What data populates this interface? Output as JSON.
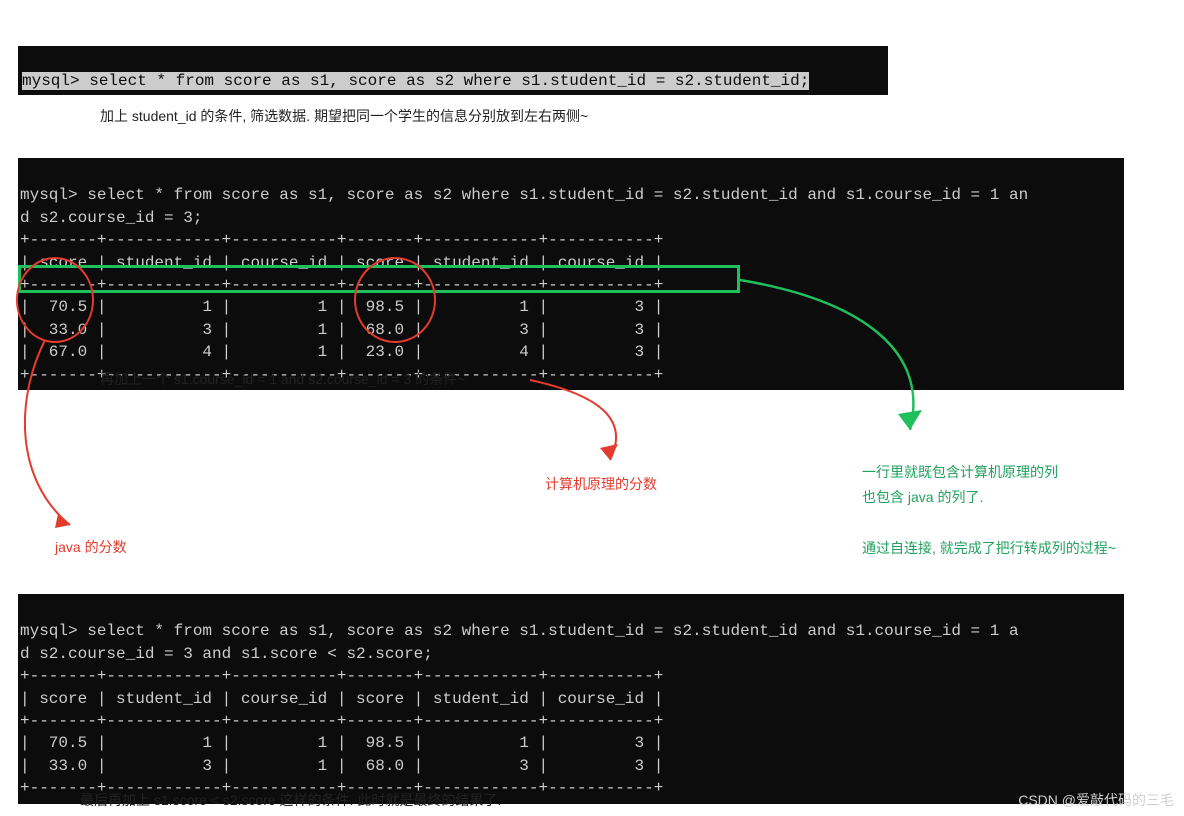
{
  "block1": {
    "line": "mysql> select * from score as s1, score as s2 where s1.student_id = s2.student_id;"
  },
  "caption1": "加上 student_id 的条件, 筛选数据. 期望把同一个学生的信息分别放到左右两侧~",
  "block2": {
    "query_l1": "mysql> select * from score as s1, score as s2 where s1.student_id = s2.student_id and s1.course_id = 1 an",
    "query_l2": "d s2.course_id = 3;",
    "sep": "+-------+------------+-----------+-------+------------+-----------+",
    "header": "| score | student_id | course_id | score | student_id | course_id |",
    "row1": "|  70.5 |          1 |         1 |  98.5 |          1 |         3 |",
    "row2": "|  33.0 |          3 |         1 |  68.0 |          3 |         3 |",
    "row3": "|  67.0 |          4 |         1 |  23.0 |          4 |         3 |"
  },
  "caption2": "再加上一个 s1.course_id = 1 and s2.course_id = 3 的条件~",
  "red_cs": "计算机原理的分数",
  "red_java": "java 的分数",
  "green_note_l1": "一行里就既包含计算机原理的列",
  "green_note_l2": "也包含 java 的列了.",
  "green_note_l3": "通过自连接, 就完成了把行转成列的过程~",
  "block3": {
    "query_l1": "mysql> select * from score as s1, score as s2 where s1.student_id = s2.student_id and s1.course_id = 1 a",
    "query_l2": "d s2.course_id = 3 and s1.score < s2.score;",
    "sep": "+-------+------------+-----------+-------+------------+-----------+",
    "header": "| score | student_id | course_id | score | student_id | course_id |",
    "row1": "|  70.5 |          1 |         1 |  98.5 |          1 |         3 |",
    "row2": "|  33.0 |          3 |         1 |  68.0 |          3 |         3 |"
  },
  "caption3": "最后再加上 s1.score < s2.score 这样的条件. 此时就是最终的结果了.",
  "watermark": "CSDN @爱敲代码的三毛"
}
